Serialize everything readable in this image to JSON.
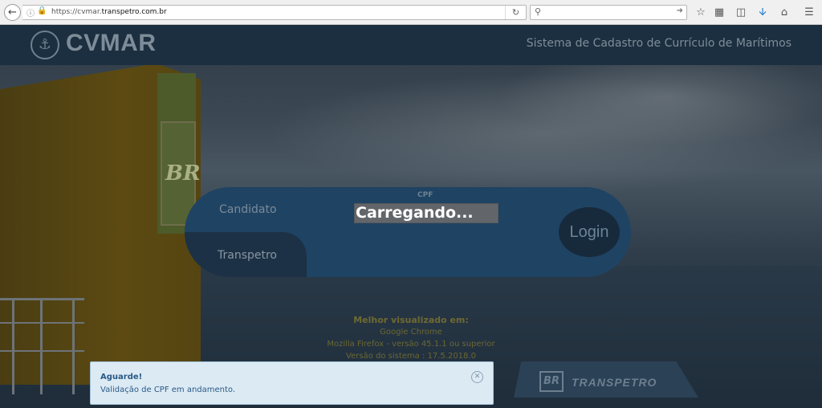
{
  "browser": {
    "url_prefix": "https://cvmar.",
    "url_domain": "transpetro.com.br",
    "search_placeholder": "",
    "icons": [
      "back-icon",
      "info-icon",
      "lock-icon",
      "reload-icon",
      "search-icon",
      "forward-arrow-icon",
      "star-icon",
      "reading-list-icon",
      "pocket-icon",
      "download-icon",
      "home-icon",
      "menu-icon"
    ]
  },
  "header": {
    "logo_text": "CVMAR",
    "subtitle": "Sistema de Cadastro de Currículo de Marítimos"
  },
  "login": {
    "tab_candidate": "Candidato",
    "tab_transpetro": "Transpetro",
    "cpf_label": "CPF",
    "cpf_value": "",
    "login_button": "Login"
  },
  "loading_text": "Carregando...",
  "best_viewed": {
    "title": "Melhor visualizado em:",
    "line1": "Google Chrome",
    "line2": "Mozilla Firefox - versão 45.1.1 ou superior",
    "line3": "Versão do sistema : 17.5.2018.0"
  },
  "footer_logo": {
    "br": "BR",
    "name": "TRANSPETRO"
  },
  "funnel_logo": "BR",
  "toast": {
    "title": "Aguarde!",
    "message": "Validação de CPF em andamento."
  },
  "colors": {
    "header_bg": "#1c2f40",
    "panel_bg": "#1f4363",
    "toast_bg": "#dceaf4",
    "toast_text": "#2a5a86"
  }
}
